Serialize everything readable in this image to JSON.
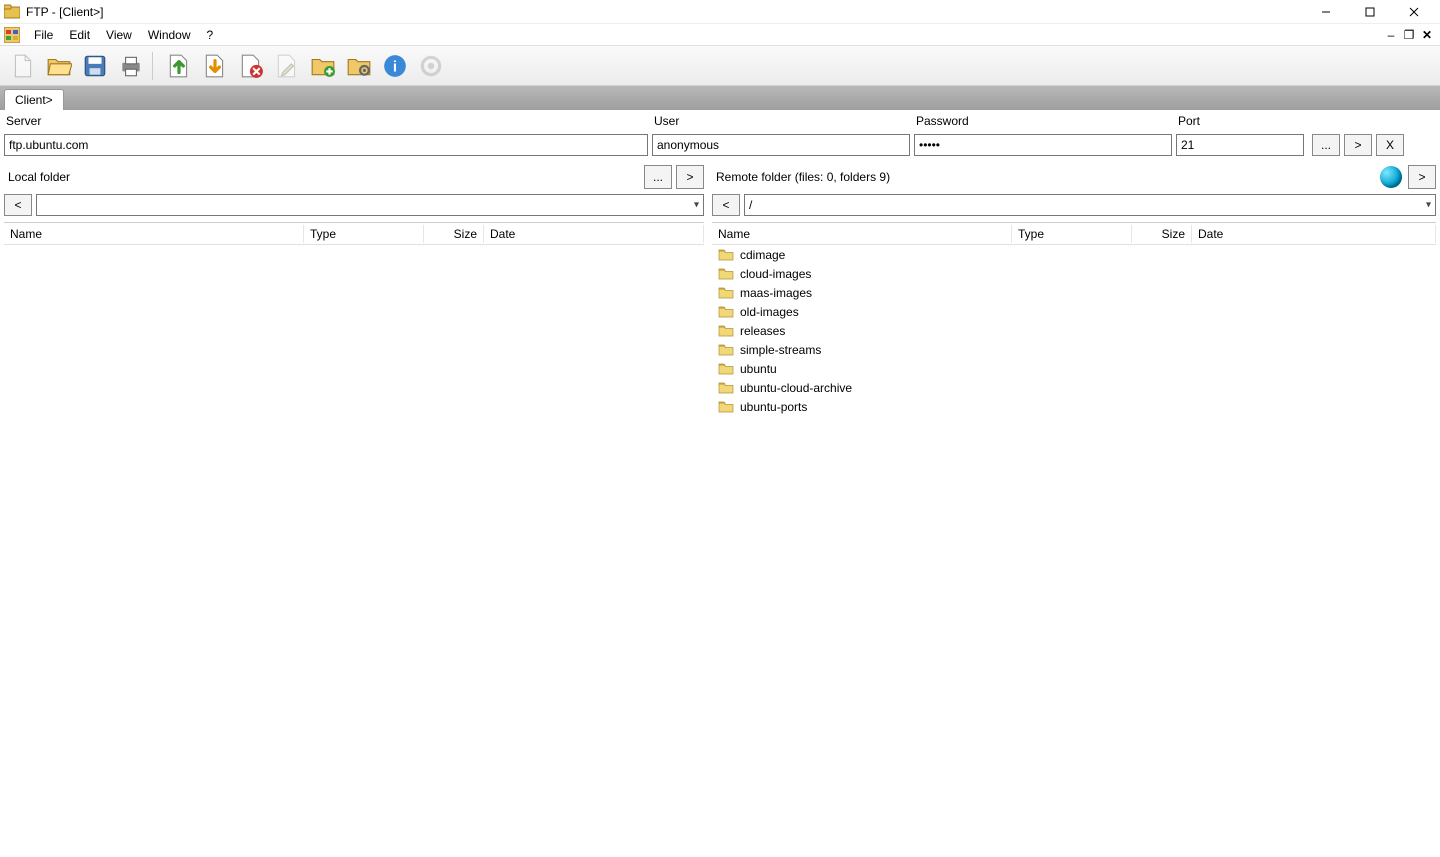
{
  "title": "FTP - [Client>]",
  "menu": {
    "file": "File",
    "edit": "Edit",
    "view": "View",
    "window": "Window",
    "help": "?"
  },
  "tab_label": "Client>",
  "conn": {
    "server_label": "Server",
    "server_value": "ftp.ubuntu.com",
    "user_label": "User",
    "user_value": "anonymous",
    "password_label": "Password",
    "password_value": "•••••",
    "port_label": "Port",
    "port_value": "21",
    "browse_btn": "...",
    "connect_btn": ">",
    "close_btn": "X"
  },
  "local": {
    "label": "Local folder",
    "browse_btn": "...",
    "go_btn": ">",
    "back_btn": "<",
    "path": ""
  },
  "remote": {
    "label": "Remote folder (files: 0, folders 9)",
    "go_btn": ">",
    "back_btn": "<",
    "path": "/"
  },
  "cols": {
    "name": "Name",
    "type": "Type",
    "size": "Size",
    "date": "Date"
  },
  "remote_items": [
    {
      "name": "cdimage"
    },
    {
      "name": "cloud-images"
    },
    {
      "name": "maas-images"
    },
    {
      "name": "old-images"
    },
    {
      "name": "releases"
    },
    {
      "name": "simple-streams"
    },
    {
      "name": "ubuntu"
    },
    {
      "name": "ubuntu-cloud-archive"
    },
    {
      "name": "ubuntu-ports"
    }
  ]
}
